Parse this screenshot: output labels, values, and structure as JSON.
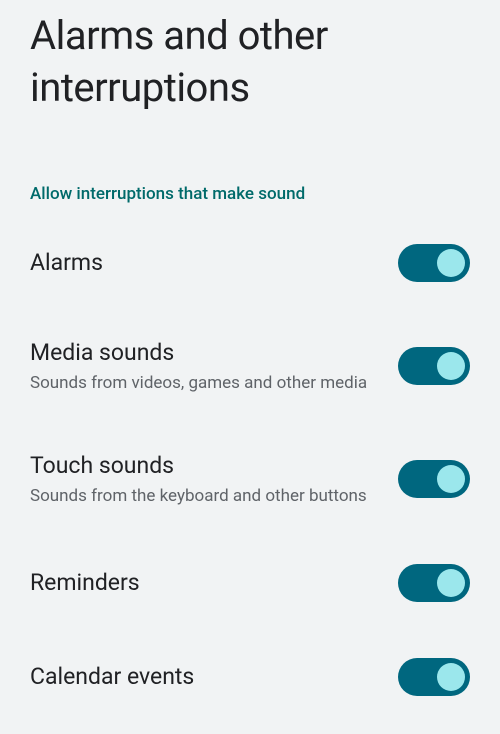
{
  "page": {
    "title": "Alarms and other interruptions"
  },
  "section": {
    "header": "Allow interruptions that make sound"
  },
  "settings": {
    "alarms": {
      "title": "Alarms",
      "on": true
    },
    "media": {
      "title": "Media sounds",
      "subtitle": "Sounds from videos, games and other media",
      "on": true
    },
    "touch": {
      "title": "Touch sounds",
      "subtitle": "Sounds from the keyboard and other buttons",
      "on": true
    },
    "reminders": {
      "title": "Reminders",
      "on": true
    },
    "calendar": {
      "title": "Calendar events",
      "on": true
    }
  },
  "colors": {
    "accent": "#006a6a",
    "toggle_track_on": "#00677f",
    "toggle_thumb_on": "#9be7ec",
    "background": "#f1f3f4"
  }
}
